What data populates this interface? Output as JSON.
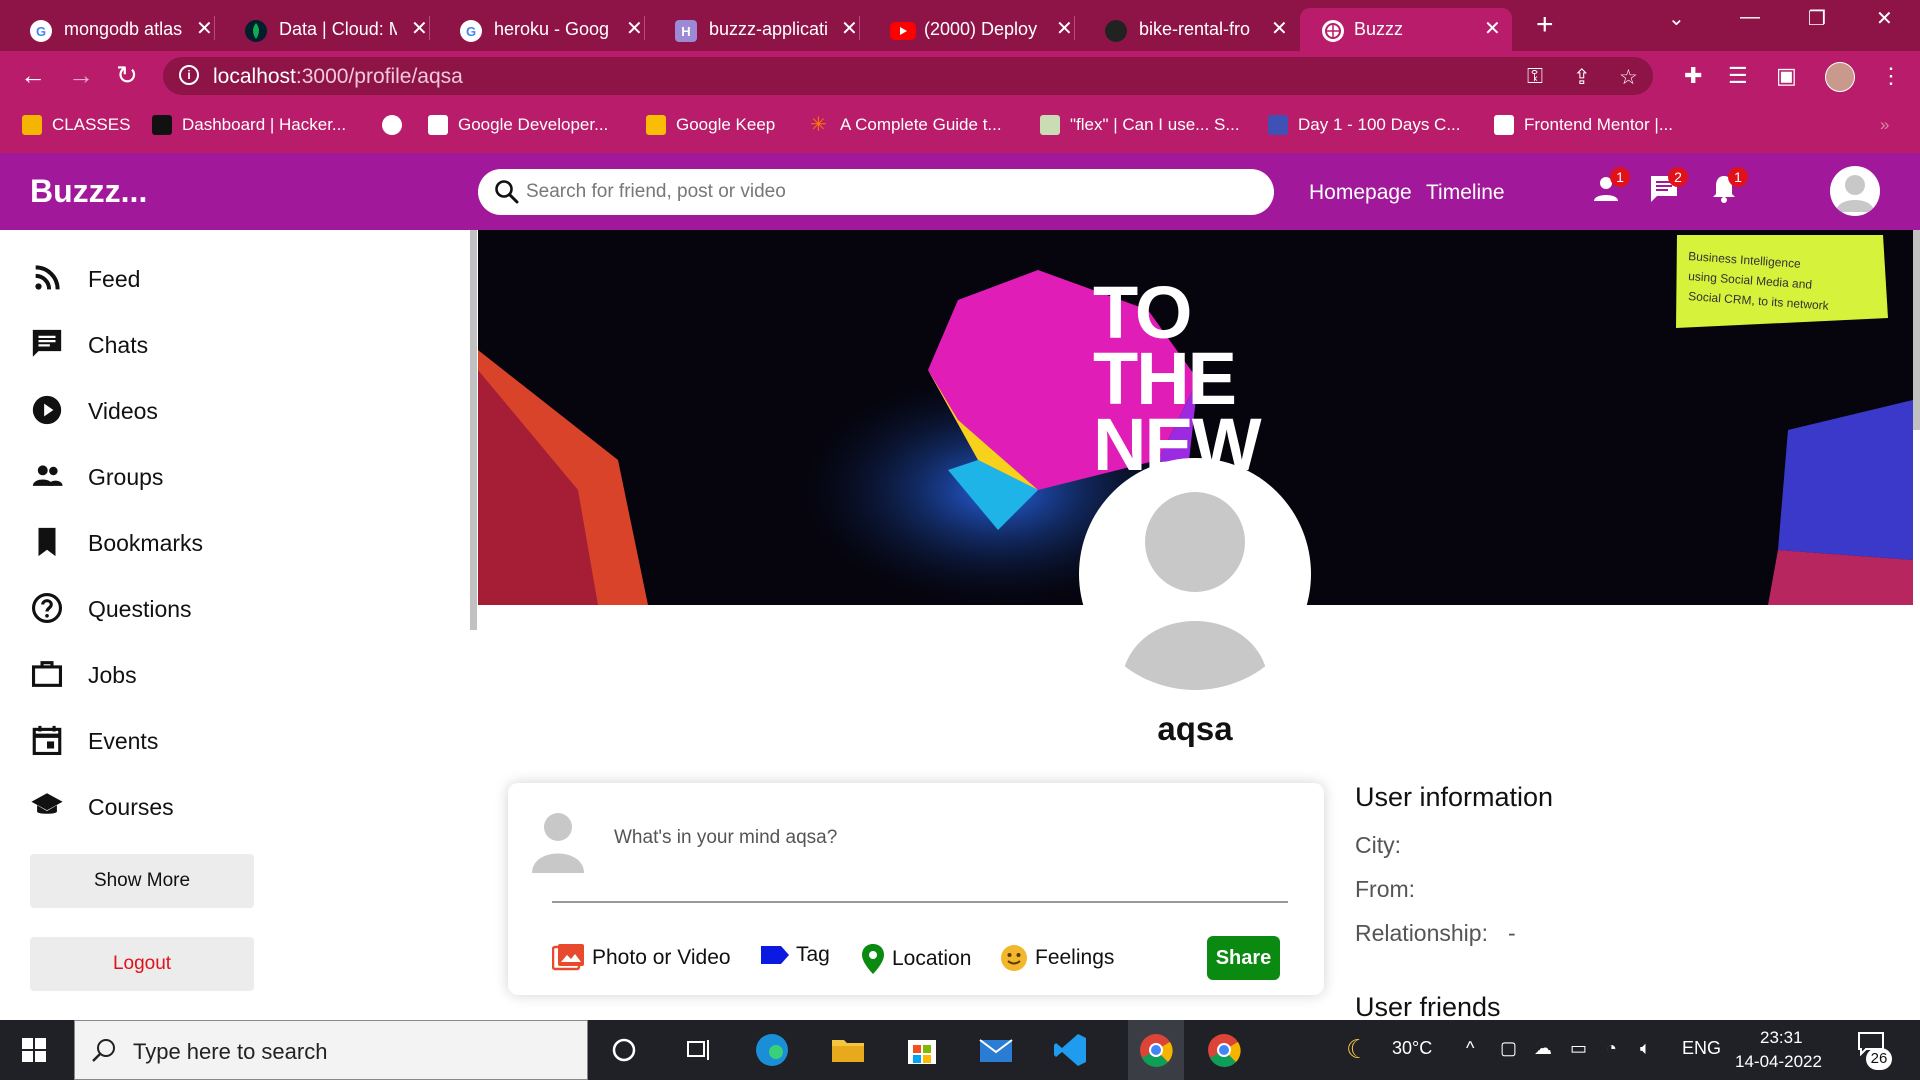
{
  "browser": {
    "tabs": [
      {
        "title": "mongodb atlas",
        "icon": "google-icon"
      },
      {
        "title": "Data | Cloud: M",
        "icon": "mongodb-leaf-icon"
      },
      {
        "title": "heroku - Goog",
        "icon": "google-icon"
      },
      {
        "title": "buzzz-applicati",
        "icon": "heroku-icon"
      },
      {
        "title": "(2000) Deploy",
        "icon": "youtube-icon"
      },
      {
        "title": "bike-rental-fro",
        "icon": "github-icon"
      },
      {
        "title": "Buzzz",
        "icon": "globe-icon"
      }
    ],
    "url_host": "localhost",
    "url_path": ":3000/profile/aqsa",
    "bookmarks": [
      "CLASSES",
      "Dashboard | Hacker...",
      "Google Developer...",
      "Google Keep",
      "A Complete Guide t...",
      "\"flex\" | Can I use... S...",
      "Day 1 - 100 Days C...",
      "Frontend Mentor |..."
    ]
  },
  "app": {
    "logo": "Buzzz...",
    "search_placeholder": "Search for friend, post or video",
    "nav": {
      "homepage": "Homepage",
      "timeline": "Timeline"
    },
    "badges": {
      "friends": "1",
      "messages": "2",
      "notifications": "1"
    }
  },
  "sidebar": {
    "items": [
      {
        "label": "Feed",
        "icon": "rss-feed-icon"
      },
      {
        "label": "Chats",
        "icon": "chat-icon"
      },
      {
        "label": "Videos",
        "icon": "play-circle-icon"
      },
      {
        "label": "Groups",
        "icon": "group-icon"
      },
      {
        "label": "Bookmarks",
        "icon": "bookmark-icon"
      },
      {
        "label": "Questions",
        "icon": "help-circle-icon"
      },
      {
        "label": "Jobs",
        "icon": "briefcase-icon"
      },
      {
        "label": "Events",
        "icon": "calendar-icon"
      },
      {
        "label": "Courses",
        "icon": "school-icon"
      }
    ],
    "show_more": "Show More",
    "logout": "Logout"
  },
  "profile": {
    "username": "aqsa",
    "cover_text": [
      "TO",
      "THE",
      "NEW"
    ],
    "share": {
      "placeholder": "What's in your mind aqsa?",
      "options": [
        "Photo or Video",
        "Tag",
        "Location",
        "Feelings"
      ],
      "button": "Share"
    },
    "info": {
      "title": "User information",
      "city_label": "City:",
      "from_label": "From:",
      "relationship_label": "Relationship:",
      "relationship_value": "-",
      "friends_title": "User friends"
    }
  },
  "taskbar": {
    "search_placeholder": "Type here to search",
    "temperature": "30°C",
    "language": "ENG",
    "time": "23:31",
    "date": "14-04-2022",
    "notification_count": "26"
  },
  "colors": {
    "tabstrip": "#8e1448",
    "toolbar": "#b81c6a",
    "appbar": "#a2189b",
    "share_button": "#0b8a11",
    "logout_text": "#e0111a",
    "badge": "#e0111a"
  }
}
